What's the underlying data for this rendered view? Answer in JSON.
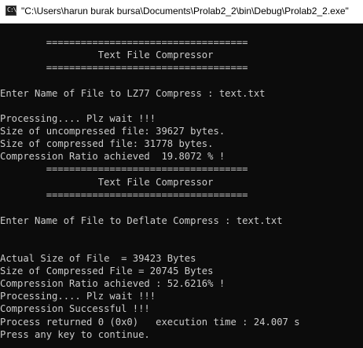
{
  "window": {
    "title": "\"C:\\Users\\harun burak bursa\\Documents\\Prolab2_2\\bin\\Debug\\Prolab2_2.exe\"",
    "icon": "console-app-icon",
    "icon_glyph": "C:\\"
  },
  "colors": {
    "console_background": "#0c0c0c",
    "console_text": "#cccccc",
    "titlebar_background": "#ffffff",
    "titlebar_text": "#000000"
  },
  "console": {
    "lines": [
      "",
      "        ===================================",
      "                 Text File Compressor",
      "        ===================================",
      "",
      "Enter Name of File to LZ77 Compress : text.txt",
      "",
      "Processing.... Plz wait !!!",
      "Size of uncompressed file: 39627 bytes.",
      "Size of compressed file: 31778 bytes.",
      "Compression Ratio achieved  19.8072 % !",
      "        ===================================",
      "                 Text File Compressor",
      "        ===================================",
      "",
      "",
      "Enter Name of File to Deflate Compress : text.txt",
      "",
      "",
      "",
      "Actual Size of File  = 39423 Bytes",
      "Size of Compressed File = 20745 Bytes",
      "Compression Ratio achieved : 52.6216% !",
      "Processing.... Plz wait !!!",
      "Compression Successful !!!",
      "Process returned 0 (0x0)   execution time : 24.007 s",
      "Press any key to continue."
    ]
  }
}
